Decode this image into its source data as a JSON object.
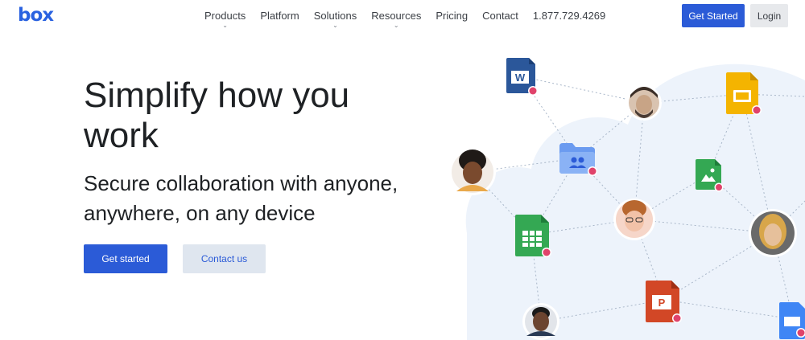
{
  "header": {
    "logo_text": "box",
    "nav": [
      {
        "label": "Products",
        "has_dropdown": true
      },
      {
        "label": "Platform",
        "has_dropdown": false
      },
      {
        "label": "Solutions",
        "has_dropdown": true
      },
      {
        "label": "Resources",
        "has_dropdown": true
      },
      {
        "label": "Pricing",
        "has_dropdown": false
      },
      {
        "label": "Contact",
        "has_dropdown": false
      },
      {
        "label": "1.877.729.4269",
        "has_dropdown": false
      }
    ],
    "get_started_label": "Get Started",
    "login_label": "Login"
  },
  "hero": {
    "title": "Simplify how you work",
    "subtitle": "Secure collaboration with anyone, anywhere, on any device",
    "primary_cta": "Get started",
    "secondary_cta": "Contact us"
  },
  "colors": {
    "brand_blue": "#2b5bd7",
    "word_blue": "#2b579a",
    "slides_yellow": "#f4b400",
    "sheets_green": "#34a853",
    "ppt_red": "#d24726",
    "folder_blue": "#6b9bf0",
    "lock_badge": "#e0436b"
  },
  "illustration": {
    "icons": [
      "word-doc-icon",
      "folder-users-icon",
      "google-slides-icon",
      "image-file-icon",
      "google-sheets-icon",
      "powerpoint-icon",
      "keynote-icon"
    ],
    "avatars": 5
  }
}
